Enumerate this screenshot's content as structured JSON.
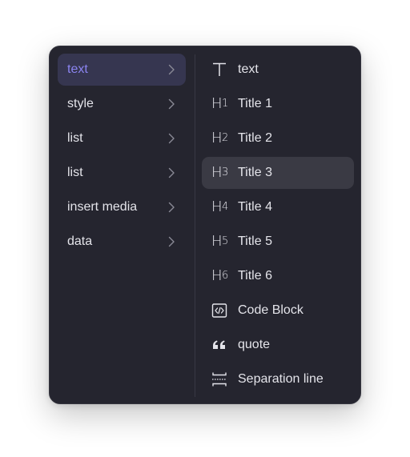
{
  "colors": {
    "panel_bg": "#25252f",
    "active_category_bg": "#363650",
    "active_category_text": "#8b84f0",
    "active_item_bg": "#3a3a44",
    "text": "#e4e4ea"
  },
  "categories": [
    {
      "label": "text",
      "icon": "chevron-right-icon",
      "active": true
    },
    {
      "label": "style",
      "icon": "chevron-right-icon"
    },
    {
      "label": "list",
      "icon": "chevron-right-icon"
    },
    {
      "label": "list",
      "icon": "chevron-right-icon"
    },
    {
      "label": "insert media",
      "icon": "chevron-right-icon"
    },
    {
      "label": "data",
      "icon": "chevron-right-icon"
    }
  ],
  "items": [
    {
      "label": "text",
      "icon": "text-icon"
    },
    {
      "label": "Title 1",
      "icon": "heading-1-icon",
      "glyph": "H",
      "level": "1"
    },
    {
      "label": "Title 2",
      "icon": "heading-2-icon",
      "glyph": "H",
      "level": "2"
    },
    {
      "label": "Title 3",
      "icon": "heading-3-icon",
      "glyph": "H",
      "level": "3",
      "active": true
    },
    {
      "label": "Title 4",
      "icon": "heading-4-icon",
      "glyph": "H",
      "level": "4"
    },
    {
      "label": "Title 5",
      "icon": "heading-5-icon",
      "glyph": "H",
      "level": "5"
    },
    {
      "label": "Title 6",
      "icon": "heading-6-icon",
      "glyph": "H",
      "level": "6"
    },
    {
      "label": "Code Block",
      "icon": "code-block-icon"
    },
    {
      "label": "quote",
      "icon": "quote-icon"
    },
    {
      "label": "Separation line",
      "icon": "separation-line-icon"
    }
  ]
}
